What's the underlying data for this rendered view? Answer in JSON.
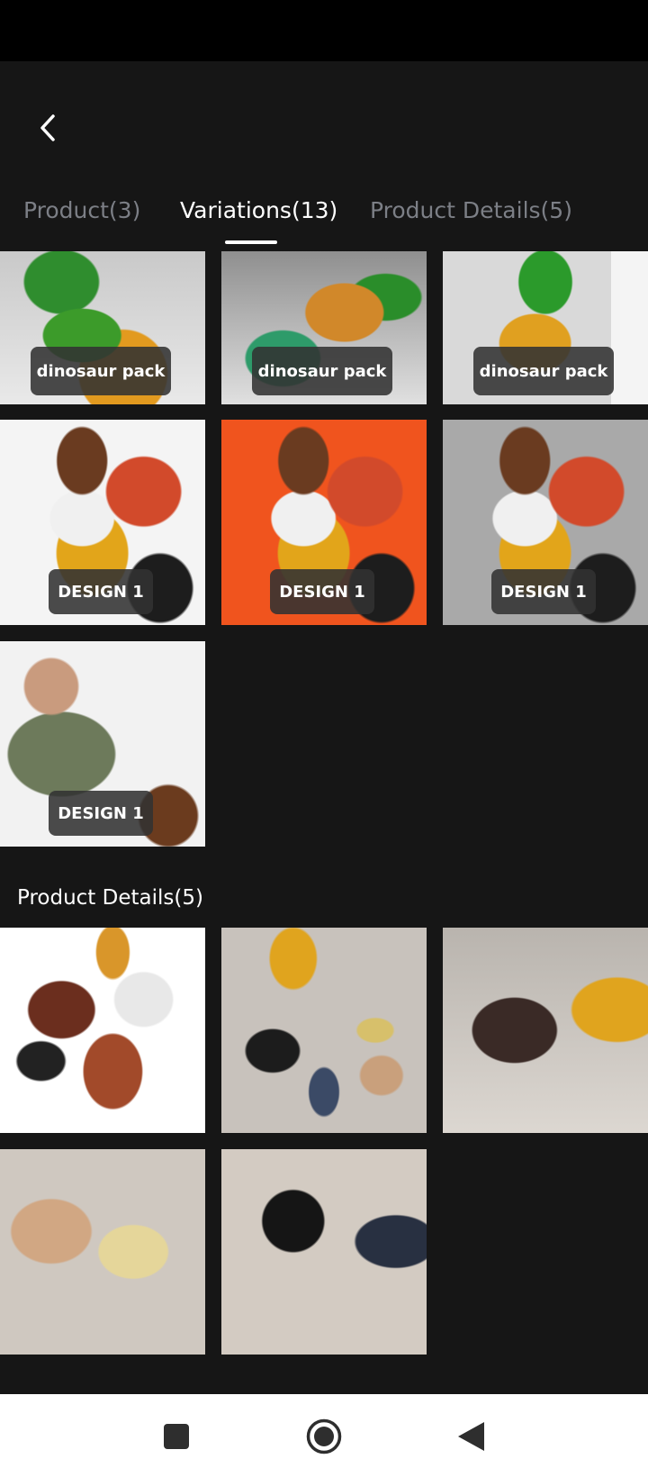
{
  "tabs": [
    {
      "label": "Product(3)"
    },
    {
      "label": "Variations(13)"
    },
    {
      "label": "Product Details(5)"
    }
  ],
  "variations": {
    "dinosaur_pack_label": "dinosaur pack",
    "design_label": "DESIGN 1"
  },
  "product_details": {
    "title": "Product Details(5)"
  },
  "colors": {
    "background": "#161616",
    "active_tab": "#ffffff",
    "inactive_tab": "#7c7f86",
    "label_bg": "#323232"
  },
  "icons": {
    "back": "chevron-left-icon",
    "nav_recents": "square-icon",
    "nav_home": "circle-icon",
    "nav_back": "triangle-back-icon"
  }
}
